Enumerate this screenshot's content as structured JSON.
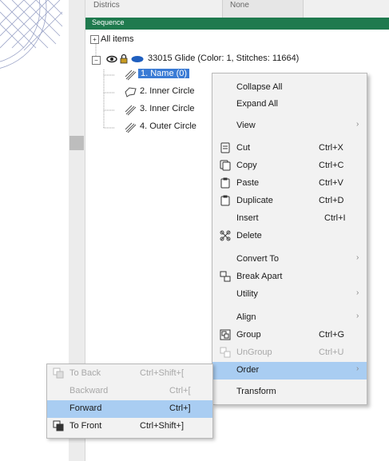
{
  "property_row": {
    "name": "Districs",
    "value": "None"
  },
  "sequence": {
    "title": "Sequence"
  },
  "tree": {
    "root": {
      "toggle": "+",
      "label": "All items"
    },
    "design": {
      "toggle": "−",
      "label": "33015 Glide (Color: 1, Stitches: 11664)"
    },
    "items": [
      {
        "label": "1. Name (0)",
        "selected": true
      },
      {
        "label": "2. Inner Circle",
        "selected": false
      },
      {
        "label": "3. Inner Circle",
        "selected": false
      },
      {
        "label": "4. Outer Circle",
        "selected": false
      }
    ]
  },
  "context_menu": {
    "collapse_all": "Collapse All",
    "expand_all": "Expand All",
    "view": "View",
    "cut": {
      "label": "Cut",
      "shortcut": "Ctrl+X"
    },
    "copy": {
      "label": "Copy",
      "shortcut": "Ctrl+C"
    },
    "paste": {
      "label": "Paste",
      "shortcut": "Ctrl+V"
    },
    "duplicate": {
      "label": "Duplicate",
      "shortcut": "Ctrl+D"
    },
    "insert": {
      "label": "Insert",
      "shortcut": "Ctrl+I"
    },
    "delete": "Delete",
    "convert_to": "Convert To",
    "break_apart": "Break Apart",
    "utility": "Utility",
    "align": "Align",
    "group": {
      "label": "Group",
      "shortcut": "Ctrl+G"
    },
    "ungroup": {
      "label": "UnGroup",
      "shortcut": "Ctrl+U"
    },
    "order": "Order",
    "transform": "Transform"
  },
  "order_submenu": {
    "to_back": {
      "label": "To Back",
      "shortcut": "Ctrl+Shift+["
    },
    "backward": {
      "label": "Backward",
      "shortcut": "Ctrl+["
    },
    "forward": {
      "label": "Forward",
      "shortcut": "Ctrl+]"
    },
    "to_front": {
      "label": "To Front",
      "shortcut": "Ctrl+Shift+]"
    }
  },
  "submenu_arrow": "›",
  "colors": {
    "sequence_header": "#1f7a4e",
    "selection": "#3a7bd5",
    "menu_highlight": "#a9cdf2"
  }
}
